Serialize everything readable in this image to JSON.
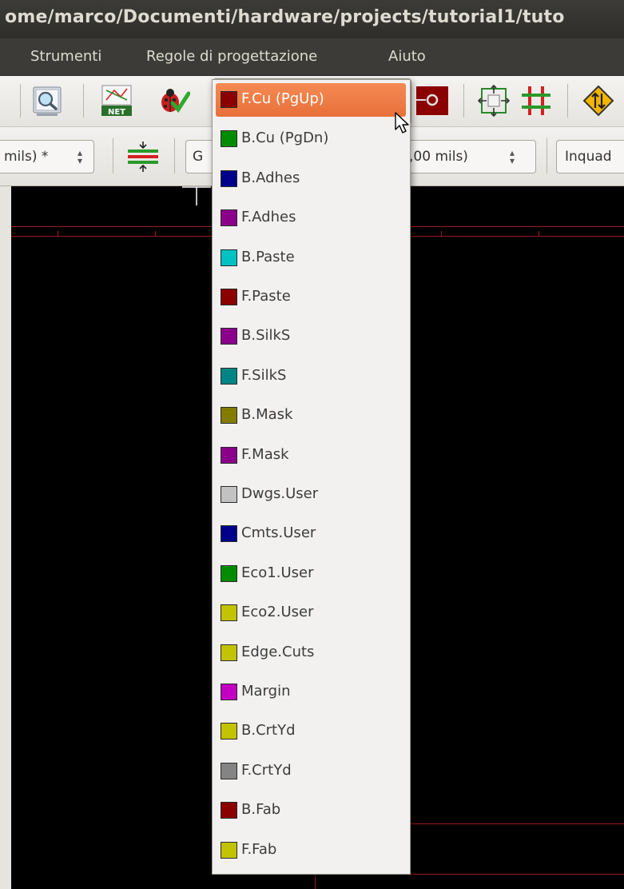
{
  "window": {
    "title": "ome/marco/Documenti/hardware/projects/tutorial1/tuto"
  },
  "menubar": {
    "items": [
      "Strumenti",
      "Regole di progettazione",
      "Aiuto"
    ]
  },
  "toolbar2": {
    "track_width_value": "mils) *",
    "grid_label_partial": "G",
    "grid_value": ",00 mils)",
    "zoom_value": "Inquad"
  },
  "layer_dropdown": {
    "selected": "F.Cu (PgUp)",
    "items": [
      {
        "label": "F.Cu (PgUp)",
        "color": "#8b0000",
        "selected": true
      },
      {
        "label": "B.Cu (PgDn)",
        "color": "#008b00"
      },
      {
        "label": "B.Adhes",
        "color": "#00008b"
      },
      {
        "label": "F.Adhes",
        "color": "#8b008b"
      },
      {
        "label": "B.Paste",
        "color": "#00c2c2"
      },
      {
        "label": "F.Paste",
        "color": "#8b0000"
      },
      {
        "label": "B.SilkS",
        "color": "#8b008b"
      },
      {
        "label": "F.SilkS",
        "color": "#008484"
      },
      {
        "label": "B.Mask",
        "color": "#847c00"
      },
      {
        "label": "F.Mask",
        "color": "#8b008b"
      },
      {
        "label": "Dwgs.User",
        "color": "#c2c2c2"
      },
      {
        "label": "Cmts.User",
        "color": "#00008b"
      },
      {
        "label": "Eco1.User",
        "color": "#008b00"
      },
      {
        "label": "Eco2.User",
        "color": "#c2c200"
      },
      {
        "label": "Edge.Cuts",
        "color": "#c2c200"
      },
      {
        "label": "Margin",
        "color": "#c200c2"
      },
      {
        "label": "B.CrtYd",
        "color": "#c2c200"
      },
      {
        "label": "F.CrtYd",
        "color": "#848484"
      },
      {
        "label": "B.Fab",
        "color": "#8b0000"
      },
      {
        "label": "F.Fab",
        "color": "#c2c200"
      }
    ]
  },
  "icons": {
    "zoom": "magnifier-icon",
    "netlist": "netlist-icon",
    "drc": "ladybug-drc-icon",
    "via": "via-icon",
    "autoplace": "autoplace-icon",
    "grid": "grid-icon",
    "direction": "direction-icon",
    "track_width": "track-width-icon"
  }
}
